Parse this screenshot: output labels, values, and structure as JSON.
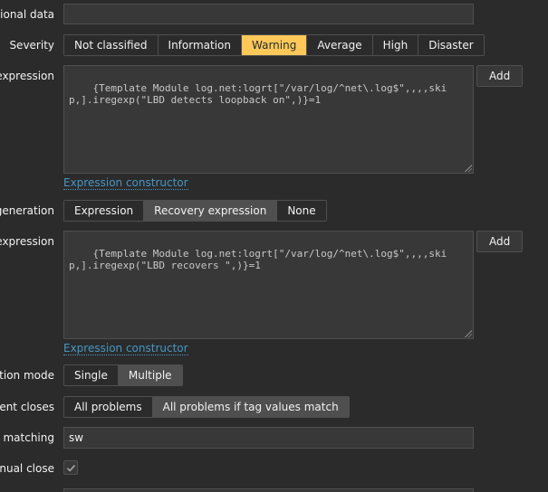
{
  "operational_data": {
    "label": "ational data",
    "value": ""
  },
  "severity": {
    "label": "Severity",
    "options": [
      "Not classified",
      "Information",
      "Warning",
      "Average",
      "High",
      "Disaster"
    ],
    "selected": "Warning"
  },
  "problem_expression": {
    "label": "expression",
    "value": "{Template Module log.net:logrt[\"/var/log/^net\\.log$\",,,,skip,].iregexp(\"LBD detects loopback on\",)}=1",
    "add_label": "Add",
    "constructor_label": "Expression constructor"
  },
  "ok_event_generation": {
    "label": "generation",
    "options": [
      "Expression",
      "Recovery expression",
      "None"
    ],
    "selected": "Recovery expression"
  },
  "recovery_expression": {
    "label": "expression",
    "value": "{Template Module log.net:logrt[\"/var/log/^net\\.log$\",,,,skip,].iregexp(\"LBD recovers \",)}=1",
    "add_label": "Add",
    "constructor_label": "Expression constructor"
  },
  "generation_mode": {
    "label": "ation mode",
    "options": [
      "Single",
      "Multiple"
    ],
    "selected": "Multiple"
  },
  "ok_event_closes": {
    "label": "vent closes",
    "options": [
      "All problems",
      "All problems if tag values match"
    ],
    "selected": "All problems if tag values match"
  },
  "tag_matching": {
    "label": "or matching",
    "value": "sw"
  },
  "manual_close": {
    "label": "anual close",
    "checked": true
  }
}
